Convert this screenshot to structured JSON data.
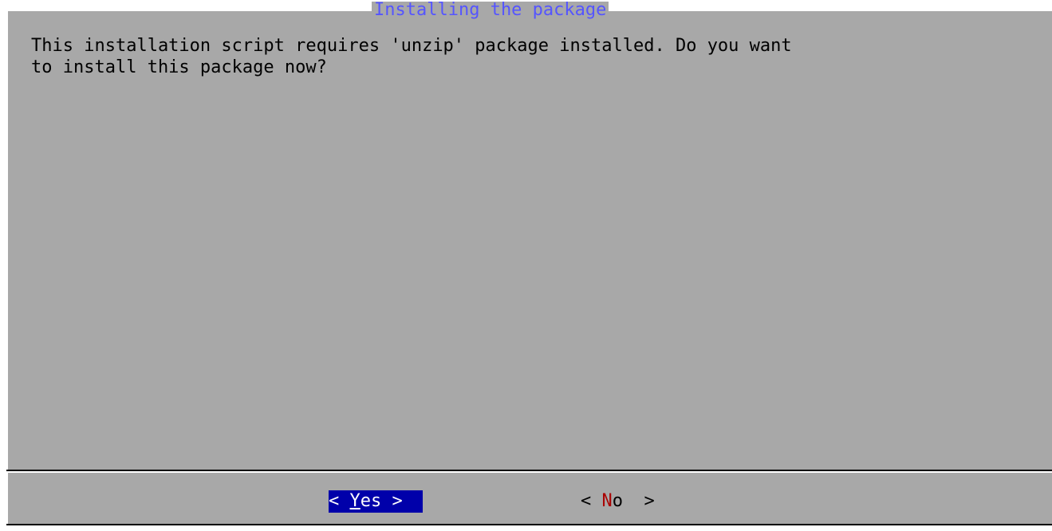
{
  "dialog": {
    "title": "Installing the package",
    "message": "This installation script requires 'unzip' package installed. Do you want\nto install this package now?"
  },
  "buttons": {
    "yes": {
      "open": "< ",
      "hotkey": "Y",
      "rest": "es",
      "close": " >"
    },
    "no": {
      "open": "< ",
      "hotkey": "N",
      "rest": "o ",
      "close": " >"
    }
  },
  "colors": {
    "dialog_background": "#a8a8a8",
    "title_text": "#5555ff",
    "selected_button_background": "#0000aa",
    "selected_button_text": "#ffffff",
    "hotkey_highlight": "#aa0000"
  }
}
